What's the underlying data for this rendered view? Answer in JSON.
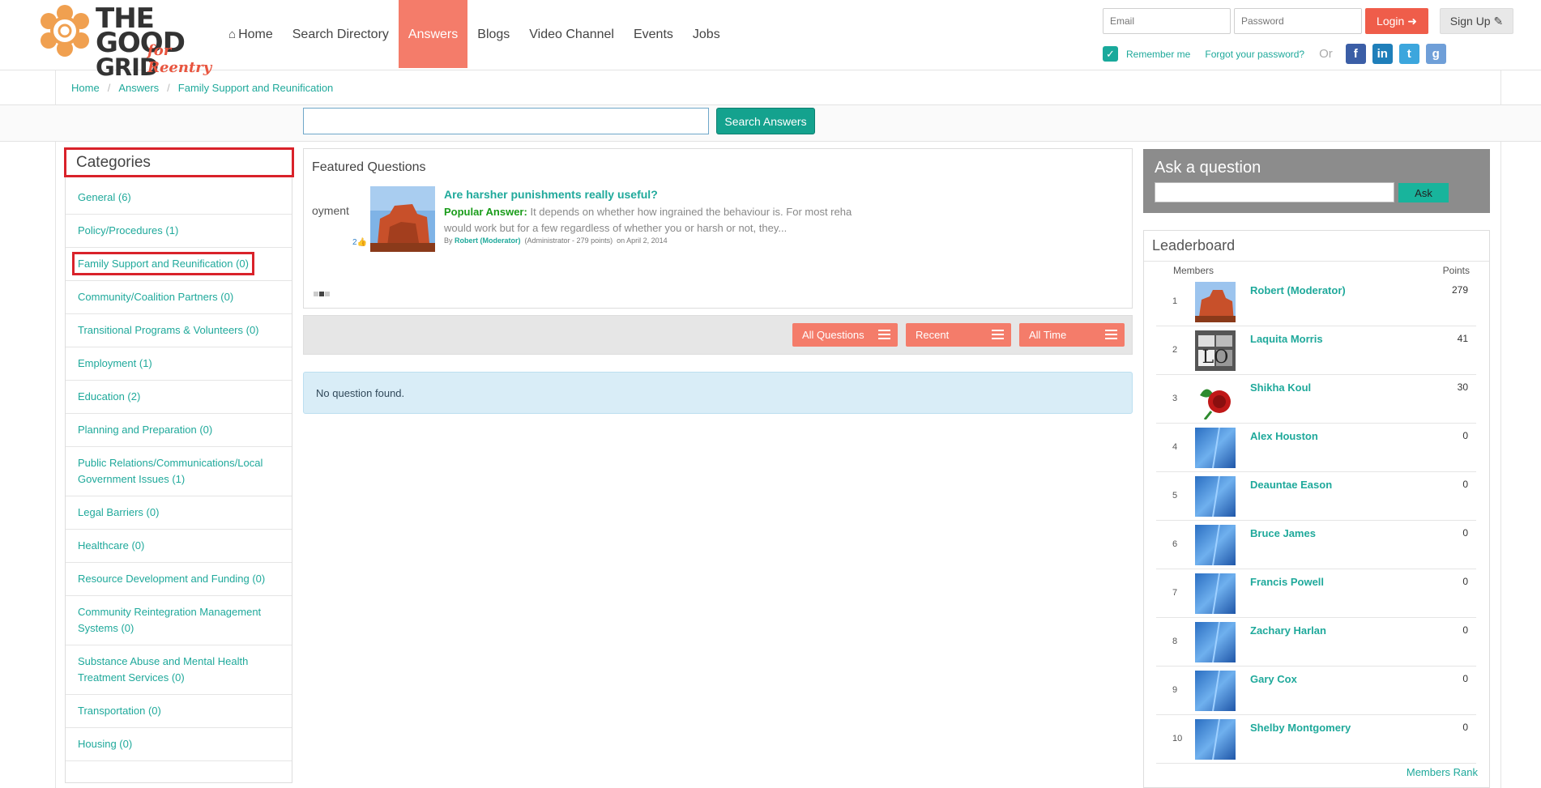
{
  "nav": {
    "logo_line1": "THE GOOD",
    "logo_line2": "GRID",
    "logo_tagline": "for Reentry",
    "items": [
      "Home",
      "Search Directory",
      "Answers",
      "Blogs",
      "Video Channel",
      "Events",
      "Jobs"
    ],
    "active": "Answers"
  },
  "auth": {
    "email_placeholder": "Email",
    "password_placeholder": "Password",
    "login_label": "Login",
    "signup_label": "Sign Up",
    "remember_label": "Remember me",
    "forgot_label": "Forgot your password?",
    "or_label": "Or"
  },
  "breadcrumb": [
    "Home",
    "Answers",
    "Family Support and Reunification"
  ],
  "search": {
    "button_label": "Search Answers"
  },
  "categories": {
    "title": "Categories",
    "items": [
      "General (6)",
      "Policy/Procedures (1)",
      "Family Support and Reunification (0)",
      "Community/Coalition Partners (0)",
      "Transitional Programs & Volunteers (0)",
      "Employment (1)",
      "Education (2)",
      "Planning and Preparation (0)",
      "Public Relations/Communications/Local Government Issues (1)",
      "Legal Barriers (0)",
      "Healthcare (0)",
      "Resource Development and Funding (0)",
      "Community Reintegration Management Systems (0)",
      "Substance Abuse and Mental Health Treatment Services (0)",
      "Transportation (0)",
      "Housing (0)"
    ],
    "highlighted": "Family Support and Reunification (0)"
  },
  "featured": {
    "title": "Featured Questions",
    "ghost_text": "oyment",
    "likes": "2",
    "question": "Are harsher punishments really useful?",
    "answer_label": "Popular Answer:",
    "answer_text": "It depends on whether how ingrained the behaviour is. For most reha would work but for a few regardless of whether you or harsh or not, they...",
    "by_prefix": "By",
    "author": "Robert (Moderator)",
    "author_meta": "(Administrator - 279 points)",
    "date": "on April 2, 2014"
  },
  "filters": [
    "All Questions",
    "Recent",
    "All Time"
  ],
  "no_results": "No question found.",
  "ask": {
    "title": "Ask a question",
    "button_label": "Ask"
  },
  "leaderboard": {
    "title": "Leaderboard",
    "col_members": "Members",
    "col_points": "Points",
    "rows": [
      {
        "rank": "1",
        "name": "Robert (Moderator)",
        "points": "279",
        "avatar": "canyon"
      },
      {
        "rank": "2",
        "name": "Laquita Morris",
        "points": "41",
        "avatar": "love"
      },
      {
        "rank": "3",
        "name": "Shikha Koul",
        "points": "30",
        "avatar": "rose"
      },
      {
        "rank": "4",
        "name": "Alex Houston",
        "points": "0",
        "avatar": "default"
      },
      {
        "rank": "5",
        "name": "Deauntae Eason",
        "points": "0",
        "avatar": "default"
      },
      {
        "rank": "6",
        "name": "Bruce James",
        "points": "0",
        "avatar": "default"
      },
      {
        "rank": "7",
        "name": "Francis Powell",
        "points": "0",
        "avatar": "default"
      },
      {
        "rank": "8",
        "name": "Zachary Harlan",
        "points": "0",
        "avatar": "default"
      },
      {
        "rank": "9",
        "name": "Gary Cox",
        "points": "0",
        "avatar": "default"
      },
      {
        "rank": "10",
        "name": "Shelby Montgomery",
        "points": "0",
        "avatar": "default"
      }
    ],
    "more_label": "Members Rank"
  },
  "colors": {
    "accent": "#f47c6a",
    "teal": "#1fa99b",
    "highlight": "#d9222a"
  }
}
